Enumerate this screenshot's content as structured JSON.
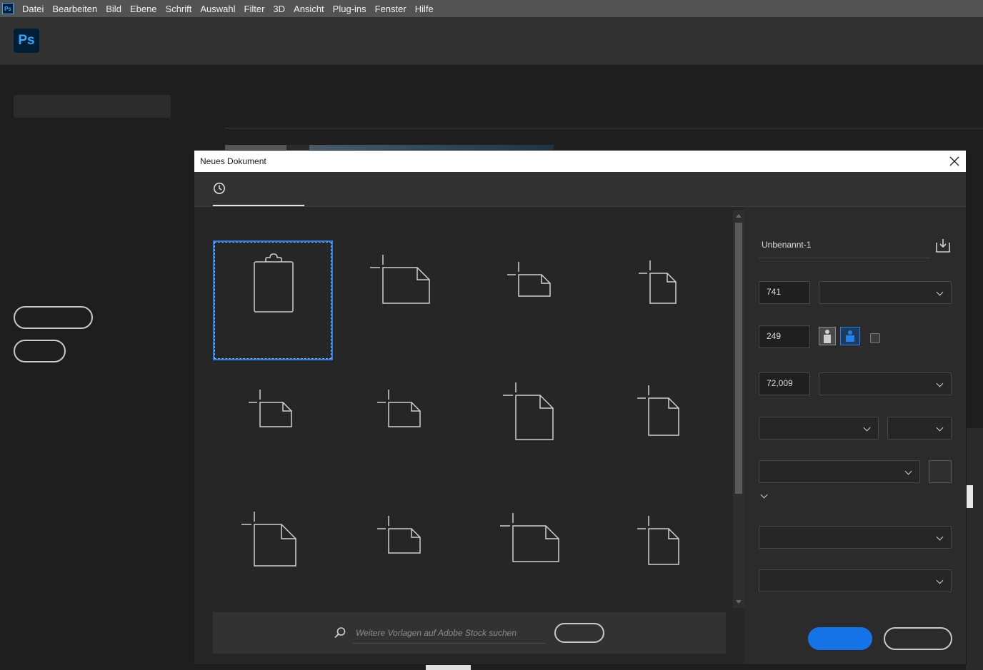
{
  "menubar": {
    "app_icon_label": "Ps",
    "items": [
      "Datei",
      "Bearbeiten",
      "Bild",
      "Ebene",
      "Schrift",
      "Auswahl",
      "Filter",
      "3D",
      "Ansicht",
      "Plug-ins",
      "Fenster",
      "Hilfe"
    ]
  },
  "home": {
    "logo_label": "Ps"
  },
  "dialog": {
    "title": "Neues Dokument",
    "tab_icon": "clock-icon",
    "search_placeholder": "Weitere Vorlagen auf Adobe Stock suchen",
    "presets": [
      {
        "icon": "clipboard-icon",
        "selected": true
      },
      {
        "icon": "document-landscape-icon"
      },
      {
        "icon": "document-landscape-icon"
      },
      {
        "icon": "document-portrait-icon"
      },
      {
        "icon": "document-landscape-icon"
      },
      {
        "icon": "document-landscape-icon"
      },
      {
        "icon": "document-portrait-icon"
      },
      {
        "icon": "document-portrait-icon"
      },
      {
        "icon": "document-portrait-icon"
      },
      {
        "icon": "document-landscape-icon"
      },
      {
        "icon": "document-landscape-icon"
      },
      {
        "icon": "document-portrait-icon"
      }
    ],
    "details": {
      "document_name": "Unbenannt-1",
      "width": "741",
      "height": "249",
      "resolution": "72,009"
    }
  },
  "colors": {
    "accent": "#1473e6",
    "selection": "#2680eb",
    "dialog_bg": "#323232"
  }
}
